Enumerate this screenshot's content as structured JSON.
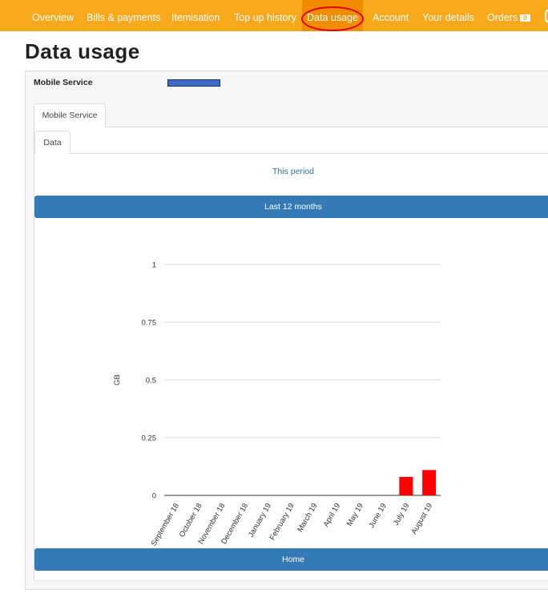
{
  "nav": {
    "items": [
      {
        "label": "Overview"
      },
      {
        "label": "Bills & payments"
      },
      {
        "label": "Itemisation"
      },
      {
        "label": "Top up history"
      },
      {
        "label": "Data usage",
        "active": true
      },
      {
        "label": "Account"
      },
      {
        "label": "Your details"
      },
      {
        "label": "Orders"
      }
    ],
    "orders_count": "0"
  },
  "page": {
    "title": "Data usage"
  },
  "service": {
    "label": "Mobile Service"
  },
  "tabs": {
    "service_tab": "Mobile Service",
    "data_tab": "Data"
  },
  "period_links": {
    "this_period": "This period",
    "last_12_months": "Last 12 months",
    "home": "Home"
  },
  "colors": {
    "nav_bg": "#f7a81b",
    "nav_active": "#f08c00",
    "accent_blue": "#337ab7",
    "bar_red": "#ff0000",
    "annotation_red": "#e00000"
  },
  "chart_data": {
    "type": "bar",
    "categories": [
      "September 18",
      "October 18",
      "November 18",
      "December 18",
      "January 19",
      "February 19",
      "March 19",
      "April 19",
      "May 19",
      "June 19",
      "July 19",
      "August 19"
    ],
    "series": [
      {
        "values": [
          0,
          0,
          0,
          0,
          0,
          0,
          0,
          0,
          0,
          0,
          0.08,
          0.11
        ]
      }
    ],
    "ylabel": "GB",
    "xlabel": "",
    "ylim": [
      0,
      1
    ],
    "yticks": [
      0,
      0.25,
      0.5,
      0.75,
      1
    ],
    "ytick_labels": [
      "0",
      "0.25",
      "0.5",
      "0.75",
      "1"
    ],
    "grid": true,
    "legend": "none"
  }
}
